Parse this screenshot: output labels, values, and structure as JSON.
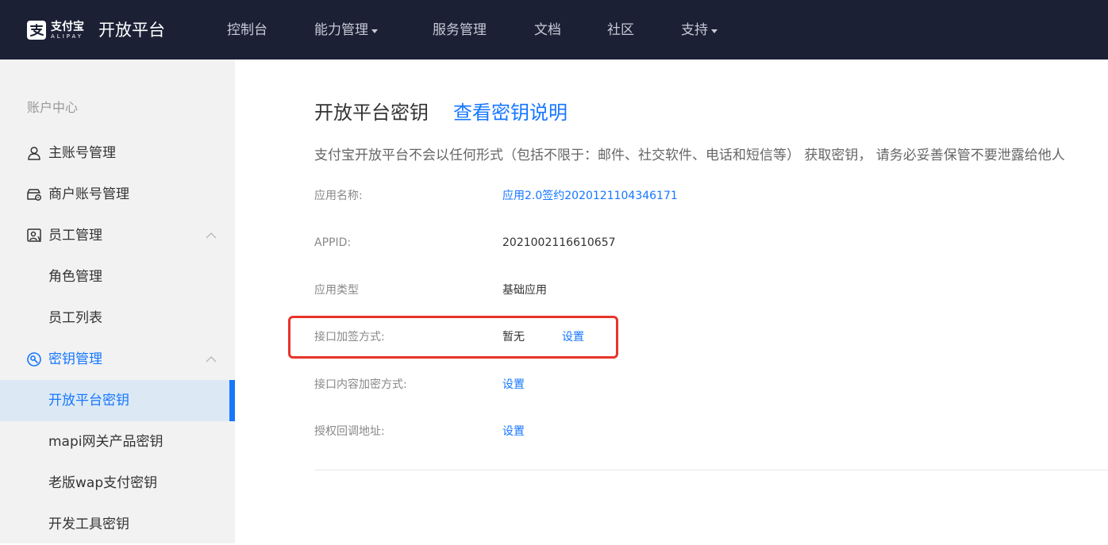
{
  "brand": {
    "logo_cn": "支付宝",
    "logo_en": "ALIPAY",
    "platform_title": "开放平台"
  },
  "nav": {
    "items": [
      {
        "label": "控制台",
        "dropdown": false
      },
      {
        "label": "能力管理",
        "dropdown": true
      },
      {
        "label": "服务管理",
        "dropdown": false
      },
      {
        "label": "文档",
        "dropdown": false
      },
      {
        "label": "社区",
        "dropdown": false
      },
      {
        "label": "支持",
        "dropdown": true
      }
    ]
  },
  "sidebar": {
    "heading": "账户中心",
    "items": [
      {
        "label": "主账号管理",
        "icon": "user-icon"
      },
      {
        "label": "商户账号管理",
        "icon": "merchant-account-icon"
      },
      {
        "label": "员工管理",
        "icon": "staff-icon",
        "expanded": true
      },
      {
        "label": "角色管理"
      },
      {
        "label": "员工列表"
      },
      {
        "label": "密钥管理",
        "icon": "key-icon",
        "expanded": true
      },
      {
        "label": "开放平台密钥",
        "active": true
      },
      {
        "label": "mapi网关产品密钥"
      },
      {
        "label": "老版wap支付密钥"
      },
      {
        "label": "开发工具密钥"
      }
    ]
  },
  "main": {
    "title": "开放平台密钥",
    "title_link": "查看密钥说明",
    "notice": "支付宝开放平台不会以任何形式（包括不限于：邮件、社交软件、电话和短信等） 获取密钥， 请务必妥善保管不要泄露给他人",
    "rows": [
      {
        "label": "应用名称:",
        "value": "应用2.0签约2020121104346171",
        "value_is_link": true
      },
      {
        "label": "APPID:",
        "value": "2021002116610657"
      },
      {
        "label": "应用类型",
        "value": "基础应用"
      },
      {
        "label": "接口加签方式:",
        "value": "暂无",
        "action": "设置"
      },
      {
        "label": "接口内容加密方式:",
        "action": "设置"
      },
      {
        "label": "授权回调地址:",
        "action": "设置"
      }
    ]
  },
  "colors": {
    "topbar": "#1b2035",
    "accent": "#1677ff",
    "highlight": "#e8342a",
    "sidebar_bg": "#f2f2f2",
    "active_bg": "#dce9f5"
  }
}
